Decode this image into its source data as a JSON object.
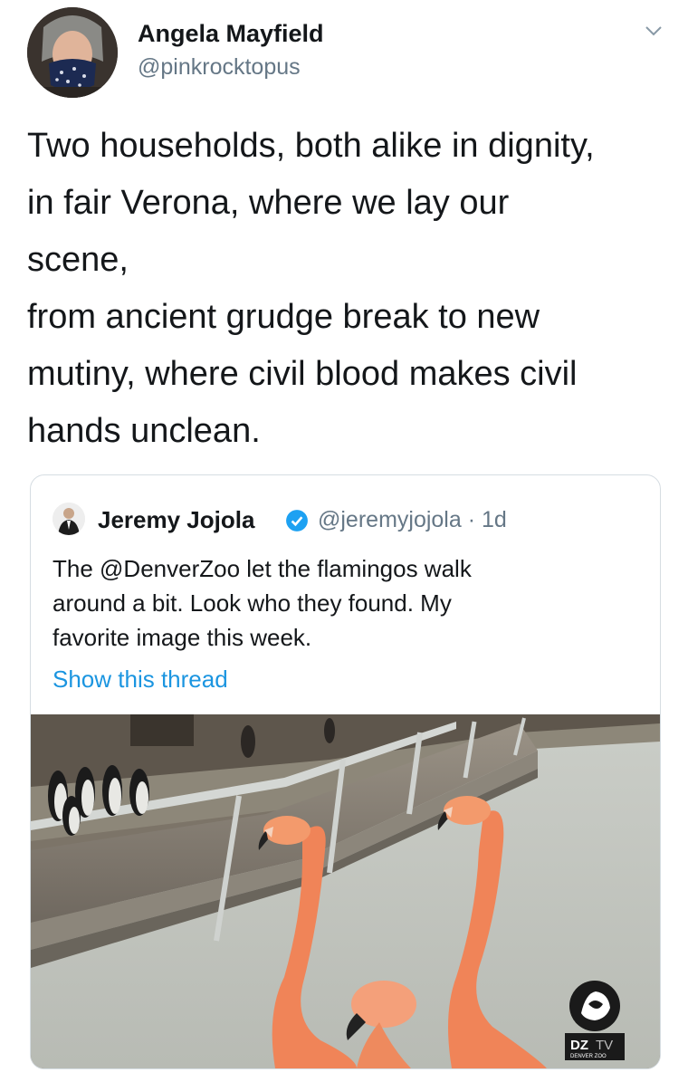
{
  "tweet": {
    "author_name": "Angela Mayfield",
    "author_handle": "@pinkrocktopus",
    "text_lines": [
      "Two households, both alike in dignity,",
      "in fair Verona, where we lay our",
      "scene,",
      "from ancient grudge break to new",
      "mutiny, where civil blood makes civil",
      "hands unclean."
    ]
  },
  "quoted_tweet": {
    "author_name": "Jeremy Jojola",
    "handle_and_time": "@jeremyjojola · 1d",
    "text_lines": [
      "The @DenverZoo let the flamingos walk",
      "around a bit. Look who they found. My",
      "favorite image this week."
    ],
    "show_thread": "Show this thread",
    "image_watermark": {
      "brand": "DZ",
      "brand_suffix": "TV",
      "subtitle": "DENVER ZOO"
    }
  },
  "colors": {
    "text": "#14171a",
    "secondary": "#657786",
    "link": "#1b95e0",
    "verified": "#1da1f2",
    "flamingo": "#f08458",
    "card_border": "#d6dde2"
  },
  "icons": [
    "chevron-down-icon",
    "verified-badge-icon"
  ]
}
